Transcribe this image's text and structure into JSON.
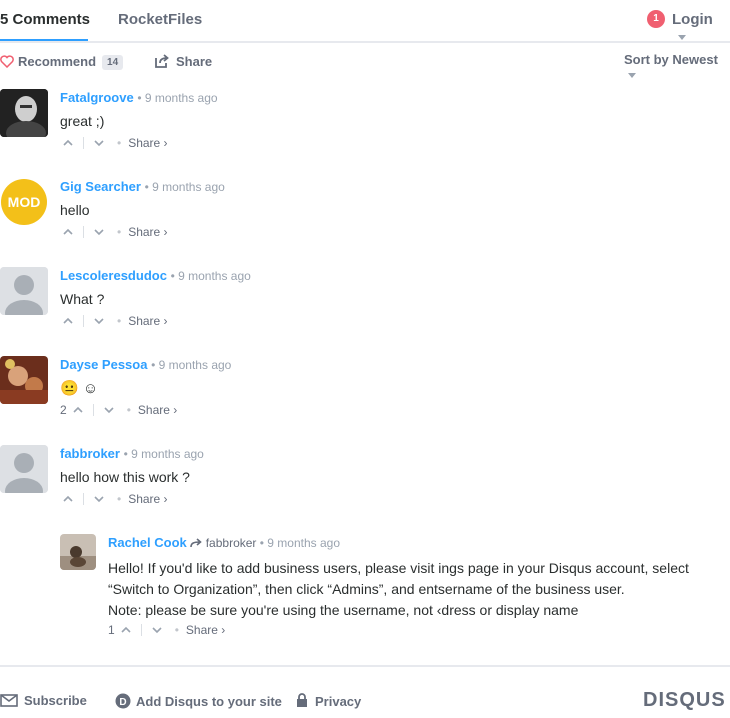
{
  "nav": {
    "comments_tab": "5 Comments",
    "site_tab": "RocketFiles",
    "login_badge": "1",
    "login_label": "Login"
  },
  "toolbar": {
    "recommend_label": "Recommend",
    "recommend_count": "14",
    "share_label": "Share",
    "sort_label": "Sort by Newest"
  },
  "comments": [
    {
      "author": "Fatalgroove",
      "time": "9 months ago",
      "text": "great ;)",
      "votes": "",
      "share": "Share ›"
    },
    {
      "author": "Gig Searcher",
      "time": "9 months ago",
      "text": "hello",
      "votes": "",
      "share": "Share ›",
      "avatar_text": "MOD"
    },
    {
      "author": "Lescoleresdudoc",
      "time": "9 months ago",
      "text": "What ?",
      "votes": "",
      "share": "Share ›"
    },
    {
      "author": "Dayse Pessoa",
      "time": "9 months ago",
      "text": "😐 ☺",
      "votes": "2",
      "share": "Share ›"
    },
    {
      "author": "fabbroker",
      "time": "9 months ago",
      "text": "hello how this work ?",
      "votes": "",
      "share": "Share ›"
    }
  ],
  "reply": {
    "author": "Rachel Cook",
    "reply_to": "fabbroker",
    "time": "9 months ago",
    "line1": "Hello! If you'd like to add business users, please visit ings page in your Disqus account, select",
    "line2": "“Switch to Organization”, then click “Admins”, and entsername of the business user.",
    "line3": "Note: please be sure you're using the username, not ‹dress or display name",
    "votes": "1",
    "share": "Share ›"
  },
  "footer": {
    "subscribe": "Subscribe",
    "add_disqus": "Add Disqus to your site",
    "privacy": "Privacy",
    "logo": "DISQUS"
  },
  "colors": {
    "accent": "#2e9fff",
    "badge": "#f05f70",
    "text": "#2a2e2e",
    "muted": "#656c7a"
  }
}
